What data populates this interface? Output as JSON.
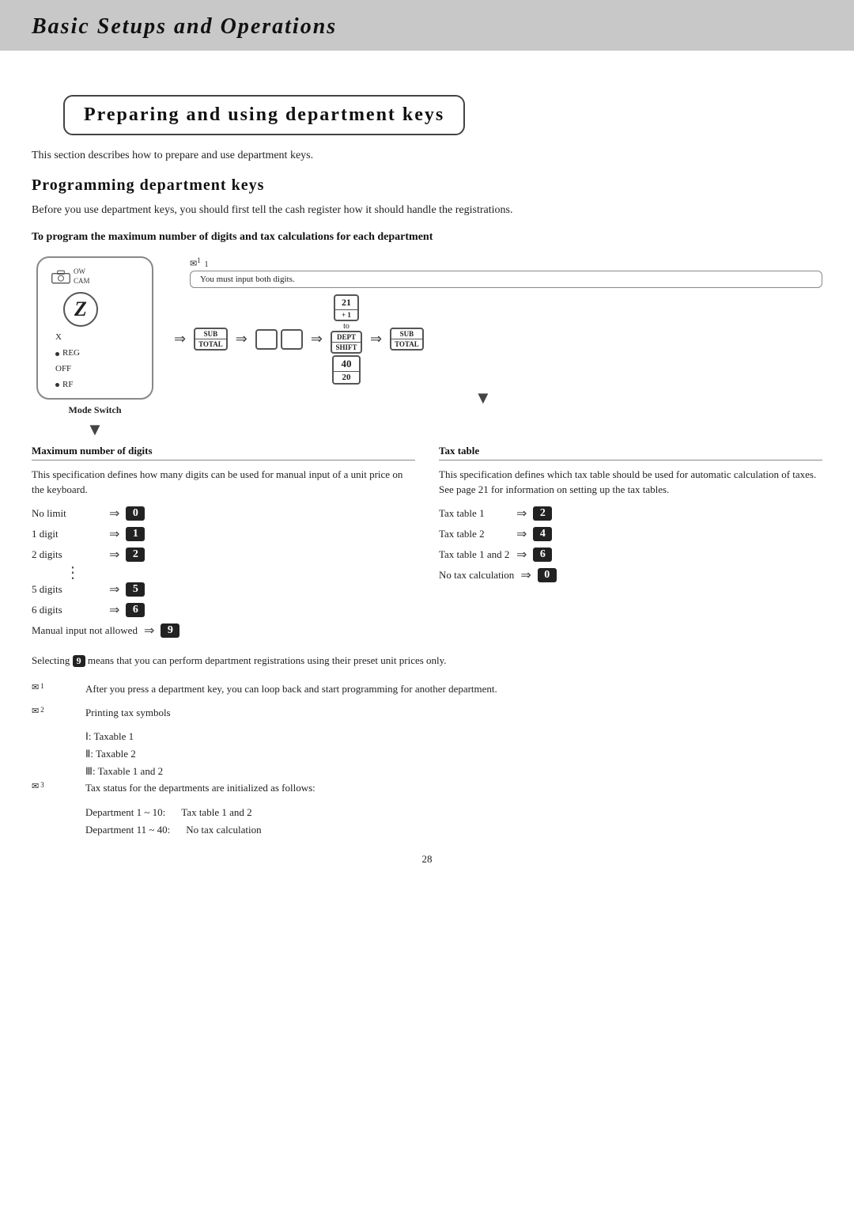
{
  "header": {
    "title": "Basic Setups and Operations"
  },
  "section": {
    "title": "Preparing and using department keys",
    "intro": "This section describes how to prepare and use department keys."
  },
  "programming": {
    "heading": "Programming department keys",
    "intro": "Before you use department keys, you should first tell the cash register how it should handle the registrations.",
    "sub_heading": "To program the maximum number of digits and tax calculations for each department"
  },
  "diagram": {
    "mode_switch_label": "Mode Switch",
    "camera_label_top": "OW",
    "camera_label_bot": "CAM",
    "z_label": "Z",
    "x_label": "X",
    "reg_label": "REG",
    "off_label": "OFF",
    "rf_label": "RF",
    "note_ref": "1",
    "flow_bubble": "You must input both digits.",
    "sub_total_top": "SUB",
    "sub_total_bot": "TOTAL",
    "blank1": "",
    "blank2": "",
    "num21_top": "21",
    "num21_bot": "+ 1",
    "to_text": "to",
    "dept40": "40",
    "dept20": "20",
    "dept_top": "DEPT",
    "dept_bot": "SHIFT"
  },
  "left_col": {
    "heading": "Maximum number of digits",
    "desc": "This specification defines how many digits can be used for manual input of a unit price on the  keyboard.",
    "rows": [
      {
        "label": "No limit",
        "value": "0"
      },
      {
        "label": "1 digit",
        "value": "1"
      },
      {
        "label": "2 digits",
        "value": "2"
      },
      {
        "label": "5 digits",
        "value": "5"
      },
      {
        "label": "6 digits",
        "value": "6"
      },
      {
        "label": "Manual input not allowed",
        "value": "9"
      }
    ]
  },
  "right_col": {
    "heading": "Tax table",
    "desc": "This specification defines which tax table should be used for automatic calculation of taxes.  See page 21 for information on setting up the tax tables.",
    "rows": [
      {
        "label": "Tax table 1",
        "value": "2"
      },
      {
        "label": "Tax table 2",
        "value": "4"
      },
      {
        "label": "Tax table 1 and 2",
        "value": "6"
      },
      {
        "label": "No tax calculation",
        "value": "0"
      }
    ]
  },
  "selecting_note": "means that you can perform department registrations using their preset unit prices only.",
  "notes": [
    {
      "num": "1",
      "text": "After you press a department key, you can loop back and start programming for another department."
    },
    {
      "num": "2",
      "text": "Printing tax symbols",
      "indent_lines": [
        "Ⅰ: Taxable 1",
        "Ⅱ: Taxable 2",
        "Ⅲ: Taxable 1 and 2"
      ]
    },
    {
      "num": "3",
      "text": "Tax status for the departments are initialized as follows:",
      "indent_lines": [
        "Department 1 ~ 10:\tTax table 1 and 2",
        "Department 11 ~ 40:\tNo tax calculation"
      ]
    }
  ],
  "page_number": "28"
}
